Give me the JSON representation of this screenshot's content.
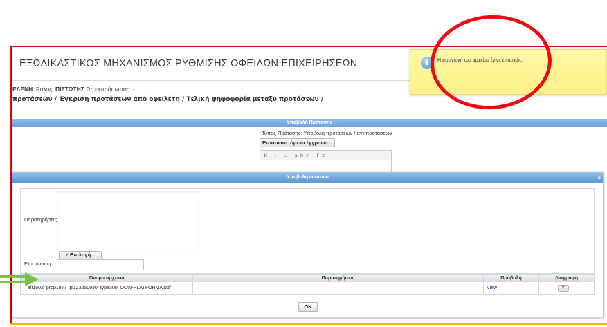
{
  "header": {
    "app_title": "ΕΞΩΔΙΚΑΣΤΙΚΟΣ ΜΗΧΑΝΙΣΜΟΣ ΡΥΘΜΙΣΗΣ ΟΦΕΙΛΩΝ ΕΠΙΧΕΙΡΗΣΕΩΝ",
    "user_name": "ΕΛΕΝΗ",
    "role_label": "Ρόλος:",
    "role_value": "ΠΙΣΤΩΤΗΣ",
    "on_behalf_label": "Ως εκπρόσωπος: -",
    "breadcrumb": "προτάσεων / Έγκριση προτάσεων από οφειλέτη / Τελική ψηφοφορία μεταξύ προτάσεων /"
  },
  "background_form": {
    "section_title": "Υποβολή Πρότασης",
    "type_label": "Τύπος Πρότασης:",
    "type_value": "Υποβολή προτάσεων / αντιπροτάσεων",
    "attachments_button": "Επισυναπτόμενα έγγραφα...",
    "editor_toolbar": "B I U abc Tx"
  },
  "modal": {
    "title": "Υποβολή εντύπου",
    "close_glyph": "×",
    "remarks_label": "Παρατηρήσεις:",
    "remarks_value": "",
    "attachment_label": "Επισύναψη:",
    "select_button": "Επιλογή...",
    "select_plus": "+",
    "attachment_value": "",
    "files_table": {
      "headers": [
        "Όνομα αρχείου",
        "Παρατηρήσεις",
        "Προβολή",
        "Διαγραφή"
      ],
      "rows": [
        {
          "file_name": "alt1502_prop1877_pi123250930_type300_OCW-PLATFORMA.pdf",
          "remarks": "",
          "view": "View",
          "delete": "×"
        }
      ]
    },
    "ok_button": "OK"
  },
  "notification": {
    "icon": "info-icon",
    "icon_glyph": "i",
    "message": "Η εισαγωγή του αρχείου έγινε επιτυχώς."
  },
  "colors": {
    "frame_border": "#e0000b",
    "section_bar": "#6da4da",
    "notification_bg": "#fbf18a",
    "annotation_circle": "#ee0a14",
    "annotation_arrow": "#7cc04a"
  }
}
